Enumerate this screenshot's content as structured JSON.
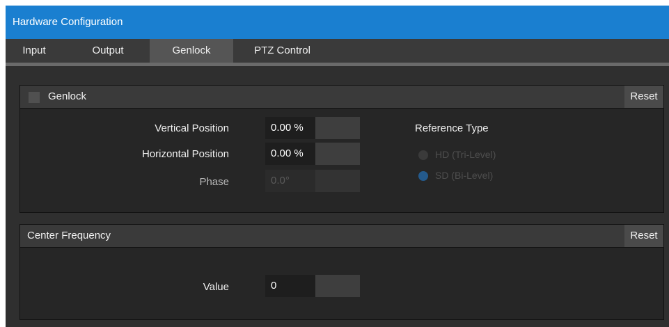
{
  "window": {
    "title": "Hardware Configuration"
  },
  "tabs": [
    {
      "label": "Input",
      "active": false
    },
    {
      "label": "Output",
      "active": false
    },
    {
      "label": "Genlock",
      "active": true
    },
    {
      "label": "PTZ Control",
      "active": false
    }
  ],
  "genlock_panel": {
    "title": "Genlock",
    "enabled": false,
    "reset_label": "Reset",
    "vertical_position": {
      "label": "Vertical Position",
      "value": "0.00 %"
    },
    "horizontal_position": {
      "label": "Horizontal Position",
      "value": "0.00 %"
    },
    "phase": {
      "label": "Phase",
      "value": "0.0°",
      "disabled": true
    },
    "reference_type": {
      "label": "Reference Type",
      "options": [
        {
          "label": "HD (Tri-Level)",
          "selected": false
        },
        {
          "label": "SD (Bi-Level)",
          "selected": true
        }
      ],
      "disabled": true
    }
  },
  "center_frequency_panel": {
    "title": "Center Frequency",
    "reset_label": "Reset",
    "value": {
      "label": "Value",
      "value": "0"
    }
  },
  "colors": {
    "titlebar": "#1a7fd0",
    "radio_selected": "#245a8c"
  }
}
